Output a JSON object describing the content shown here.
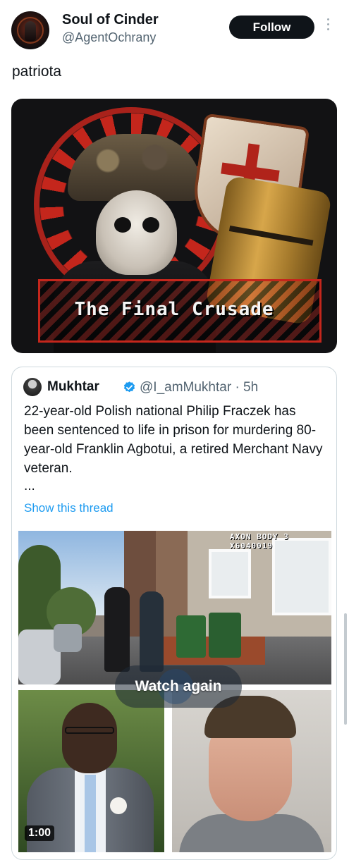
{
  "author": {
    "display_name": "Soul of Cinder",
    "handle": "@AgentOchrany",
    "avatar_icon": "avatar-image"
  },
  "follow_label": "Follow",
  "more_icon": "more-vertical-icon",
  "tweet_text": "patriota",
  "media": {
    "caption": "The Final Crusade"
  },
  "quote": {
    "author_name": "Mukhtar",
    "verified_icon": "verified-badge-icon",
    "verified_color": "#1d9bf0",
    "handle_time": "@I_amMukhtar · 5h",
    "text": "22-year-old Polish national Philip Fraczek has been sentenced to life in prison for murdering 80-year-old Franklin Agbotui, a retired Merchant Navy veteran.",
    "ellipsis": "...",
    "show_thread": "Show this thread",
    "video": {
      "camera_label": "AXON BODY 3 X6040019",
      "watch_again": "Watch again",
      "duration": "1:00"
    }
  },
  "colors": {
    "accent": "#1d9bf0",
    "follow_bg": "#0f1419",
    "secondary_text": "#536471",
    "border": "#cfd9de"
  }
}
